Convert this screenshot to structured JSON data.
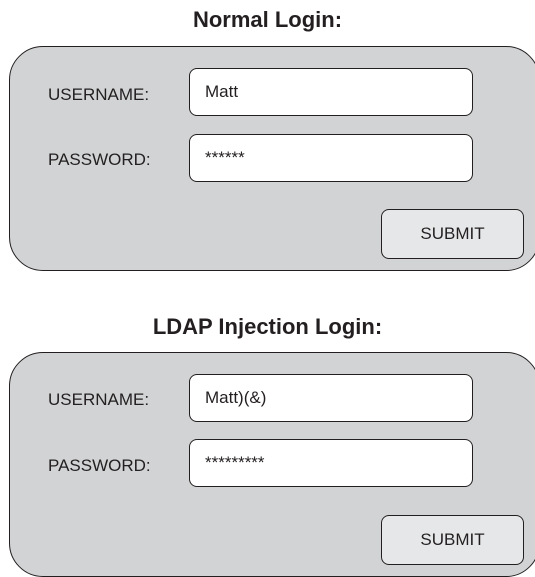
{
  "normal_login": {
    "title": "Normal Login:",
    "username_label": "USERNAME:",
    "username_value": "Matt",
    "password_label": "PASSWORD:",
    "password_value": "******",
    "submit_label": "SUBMIT"
  },
  "ldap_login": {
    "title": "LDAP Injection Login:",
    "username_label": "USERNAME:",
    "username_value": "Matt)(&)",
    "password_label": "PASSWORD:",
    "password_value": "*********",
    "submit_label": "SUBMIT"
  },
  "colors": {
    "panel_fill": "#d1d3d4",
    "input_fill": "#ffffff",
    "button_fill": "#e6e7e8",
    "outline": "#231f20"
  }
}
